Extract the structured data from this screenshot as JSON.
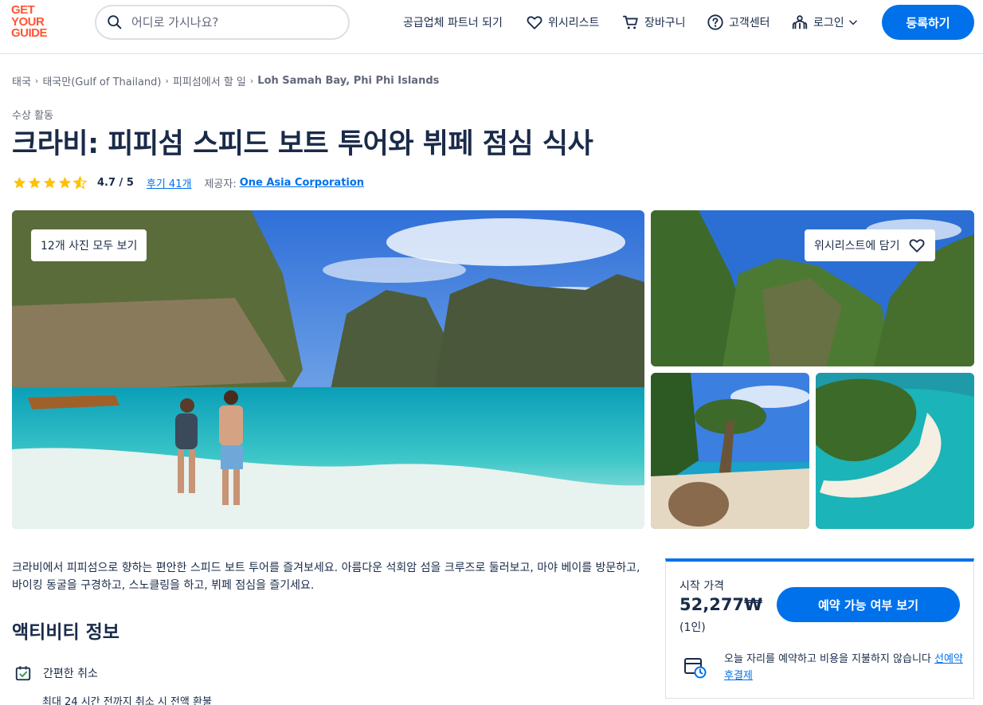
{
  "brand": {
    "logo_lines": [
      "GET",
      "YOUR",
      "GUIDE"
    ],
    "accent": "#ff5533",
    "primary": "#0071eb"
  },
  "search": {
    "placeholder": "어디로 가시나요?"
  },
  "nav": {
    "partner": "공급업체 파트너 되기",
    "wishlist": "위시리스트",
    "cart": "장바구니",
    "help": "고객센터",
    "login": "로그인",
    "signup": "등록하기"
  },
  "breadcrumb": [
    "태국",
    "태국만(Gulf of Thailand)",
    "피피섬에서 할 일",
    "Loh Samah Bay, Phi Phi Islands"
  ],
  "activity": {
    "category": "수상 활동",
    "title": "크라비: 피피섬 스피드 보트 투어와 뷔페 점심 식사",
    "rating": "4.7 / 5",
    "stars": 4.7,
    "reviews": "후기 41개",
    "provider_label": "제공자:",
    "provider": "One Asia Corporation"
  },
  "gallery": {
    "all_photos": "12개 사진 모두 보기",
    "wishlist_add": "위시리스트에 담기"
  },
  "description": "크라비에서 피피섬으로 향하는 편안한 스피드 보트 투어를 즐겨보세요. 아름다운 석회암 섬을 크루즈로 둘러보고, 마야 베이를 방문하고, 바이킹 동굴을 구경하고, 스노클링을 하고, 뷔페 점심을 즐기세요.",
  "info": {
    "title": "액티비티 정보",
    "features": [
      {
        "icon": "calendar-check-icon",
        "label": "간편한 취소",
        "sub": "최대 24 시간 전까지 취소 시 전액 환불"
      }
    ]
  },
  "booking": {
    "price_label": "시작 가격",
    "price": "52,277₩",
    "per": "(1인)",
    "cta": "예약 가능 여부 보기",
    "reserve_text": "오늘 자리를 예약하고 비용을 지불하지 않습니다",
    "reserve_link": "선예약 후결제"
  }
}
